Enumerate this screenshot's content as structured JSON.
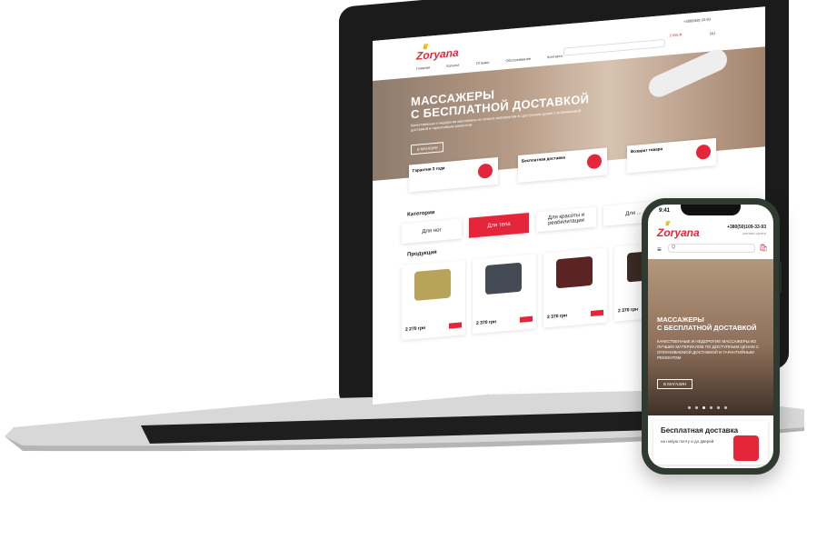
{
  "laptop": {
    "logo": "Zoryana",
    "nav": [
      "Главная",
      "Каталог",
      "Отзывы",
      "Обслуживание",
      "Контакты"
    ],
    "phone": "+380(050)-33-93",
    "cart_total": "2 555 ₴",
    "lang": "RU",
    "hero": {
      "title_line1": "МАССАЖЕРЫ",
      "title_line2": "С БЕСПЛАТНОЙ ДОСТАВКОЙ",
      "subtitle": "Качественные и недорогие массажеры из лучших материалов по доступным ценам с оплачиваемой доставкой и гарантийным ремонтом",
      "button": "В МАГАЗИН"
    },
    "benefits": [
      "Гарантия 3 года",
      "Бесплатная доставка",
      "Возврат товара"
    ],
    "categories_title": "Категории",
    "categories": [
      "Для ног",
      "Для тела",
      "Для красоты и реабилитации",
      "Для ..."
    ],
    "products_title": "Продукция",
    "products": [
      {
        "price": "2 270 грн"
      },
      {
        "price": "2 370 грн"
      },
      {
        "price": "2 370 грн"
      },
      {
        "price": "2 370 грн"
      }
    ]
  },
  "phone": {
    "time": "9:41",
    "logo": "Zoryana",
    "phone": "+380(50)109-33-93",
    "contact_center": "контакт-центр",
    "search_placeholder": "Q",
    "hero": {
      "title_line1": "МАССАЖЕРЫ",
      "title_line2": "С БЕСПЛАТНОЙ ДОСТАВКОЙ",
      "subtitle": "КАЧЕСТВЕННЫЕ И НЕДОРОГИЕ МАССАЖЕРЫ ИЗ ЛУЧШИХ МАТЕРИАЛОВ ПО ДОСТУПНЫМ ЦЕНАМ С ОПЛАЧИВАЕМОЙ ДОСТАВКОЙ И ГАРАНТИЙНЫМ РЕМОНТОМ",
      "button": "В МАГАЗИН"
    },
    "benefit_title": "Бесплатная доставка",
    "benefit_sub": "на новую почту и до дверей"
  }
}
